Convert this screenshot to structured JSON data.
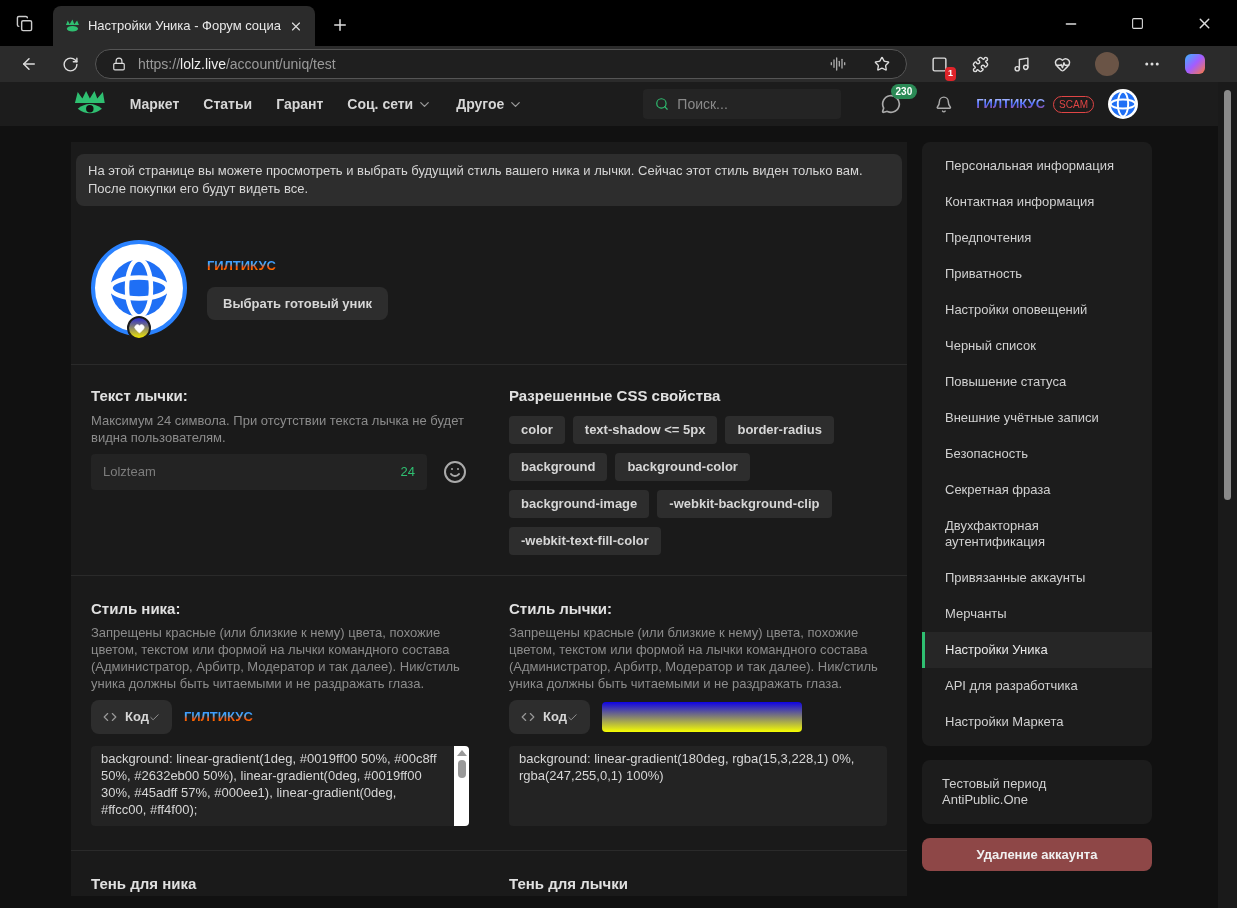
{
  "browser": {
    "tab_title": "Настройки Уника - Форум социа",
    "url_scheme": "https://",
    "url_host": "lolz.live",
    "url_path": "/account/uniq/test",
    "extension_badge": "1"
  },
  "header": {
    "nav": [
      {
        "label": "Маркет",
        "dropdown": false
      },
      {
        "label": "Статьи",
        "dropdown": false
      },
      {
        "label": "Гарант",
        "dropdown": false
      },
      {
        "label": "Соц. сети",
        "dropdown": true
      },
      {
        "label": "Другое",
        "dropdown": true
      }
    ],
    "search": {
      "placeholder": "Поиск..."
    },
    "messages_badge": "230",
    "username": "ГИЛТИКУС",
    "user_tag": "SCAM"
  },
  "notice": "На этой странице вы можете просмотреть и выбрать будущий стиль вашего ника и лычки. Сейчас этот стиль виден только вам. После покупки его будут видеть все.",
  "profile": {
    "username": "ГИЛТИКУС",
    "button": "Выбрать готовый уник"
  },
  "badge_text": {
    "title": "Текст лычки:",
    "hint": "Максимум 24 символа. При отсутствии текста лычка не будет видна пользователям.",
    "placeholder": "Lolzteam",
    "counter": "24"
  },
  "css": {
    "title": "Разрешенные CSS свойства",
    "properties": [
      "color",
      "text-shadow <= 5px",
      "border-radius",
      "background",
      "background-color",
      "background-image",
      "-webkit-background-clip",
      "-webkit-text-fill-color"
    ]
  },
  "nick_style": {
    "title": "Стиль ника:",
    "description": "Запрещены красные (или близкие к нему) цвета, похожие цветом, текстом или формой на лычки командного состава (Администратор, Арбитр, Модератор и так далее). Ник/стиль уника должны быть читаемыми и не раздражать глаза.",
    "code_button": "Код",
    "preview": "ГИЛТИКУС",
    "code": "background: linear-gradient(1deg, #0019ff00 50%, #00c8ff 50%, #2632eb00 50%), linear-gradient(0deg, #0019ff00 30%, #45adff 57%, #000ee1), linear-gradient(0deg, #ffcc00, #ff4f00);"
  },
  "badge_style": {
    "title": "Стиль лычки:",
    "description": "Запрещены красные (или близкие к нему) цвета, похожие цветом, текстом или формой на лычки командного состава (Администратор, Арбитр, Модератор и так далее). Ник/стиль уника должны быть читаемыми и не раздражать глаза.",
    "code_button": "Код",
    "code": "background: linear-gradient(180deg, rgba(15,3,228,1) 0%, rgba(247,255,0,1) 100%)"
  },
  "shadows": [
    "Тень для ника",
    "Тень для лычки"
  ],
  "sidebar": {
    "items": [
      {
        "label": "Персональная информация",
        "selected": false
      },
      {
        "label": "Контактная информация",
        "selected": false
      },
      {
        "label": "Предпочтения",
        "selected": false
      },
      {
        "label": "Приватность",
        "selected": false
      },
      {
        "label": "Настройки оповещений",
        "selected": false
      },
      {
        "label": "Черный список",
        "selected": false
      },
      {
        "label": "Повышение статуса",
        "selected": false
      },
      {
        "label": "Внешние учётные записи",
        "selected": false
      },
      {
        "label": "Безопасность",
        "selected": false
      },
      {
        "label": "Секретная фраза",
        "selected": false
      },
      {
        "label": "Двухфакторная аутентификация",
        "selected": false
      },
      {
        "label": "Привязанные аккаунты",
        "selected": false
      },
      {
        "label": "Мерчанты",
        "selected": false
      },
      {
        "label": "Настройки Уника",
        "selected": true
      },
      {
        "label": "API для разработчика",
        "selected": false
      },
      {
        "label": "Настройки Маркета",
        "selected": false
      }
    ],
    "extra": "Тестовый период AntiPublic.One",
    "delete_button": "Удаление аккаунта"
  }
}
